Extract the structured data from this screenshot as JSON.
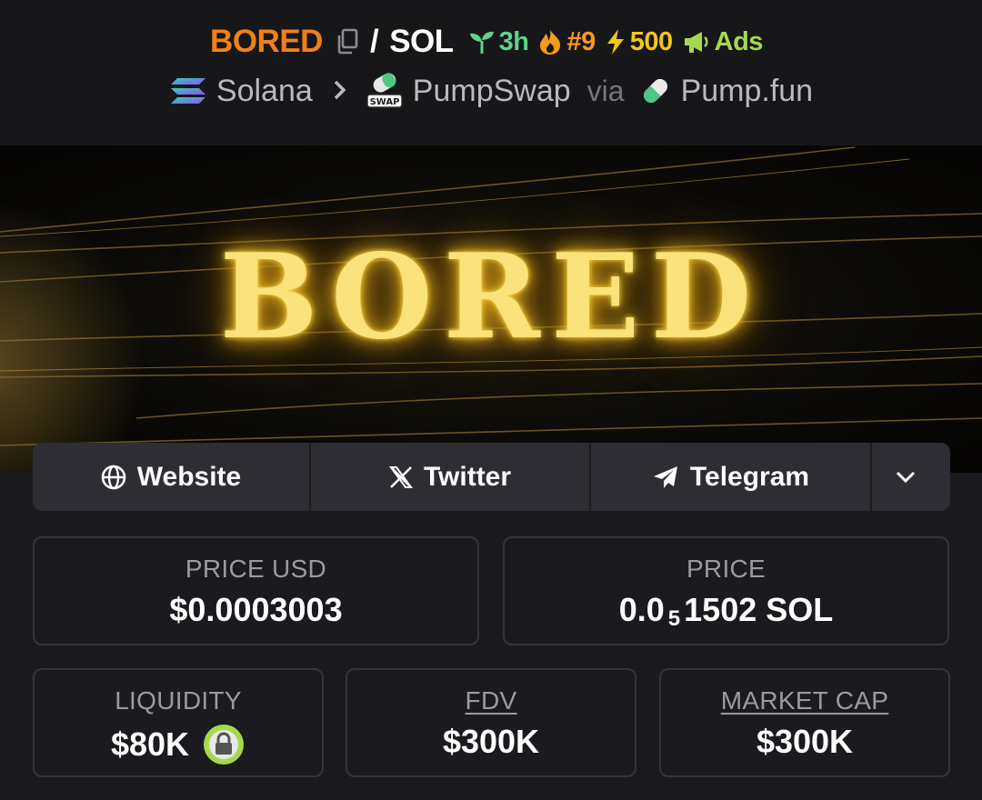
{
  "header": {
    "symbol": "BORED",
    "slash": "/",
    "quote": "SOL",
    "age": "3h",
    "rank": "#9",
    "boosts": "500",
    "ads": "Ads",
    "chain": "Solana",
    "dex": "PumpSwap",
    "via": "via",
    "launchpad": "Pump.fun",
    "dex_icon_text": "SWAP"
  },
  "banner": {
    "title": "BORED"
  },
  "links": {
    "website": "Website",
    "twitter": "Twitter",
    "telegram": "Telegram"
  },
  "stats": {
    "price_usd_label": "PRICE USD",
    "price_usd_value": "$0.0003003",
    "price_label": "PRICE",
    "price_prefix": "0.0",
    "price_zeros": "5",
    "price_suffix": "1502 SOL",
    "liquidity_label": "LIQUIDITY",
    "liquidity_value": "$80K",
    "fdv_label": "FDV",
    "fdv_value": "$300K",
    "mcap_label": "MARKET CAP",
    "mcap_value": "$300K"
  },
  "colors": {
    "symbol": "#f0801a",
    "age": "#5fd38a",
    "rank": "#f59a1c",
    "boosts": "#f4c51a",
    "ads": "#a6d84e"
  }
}
